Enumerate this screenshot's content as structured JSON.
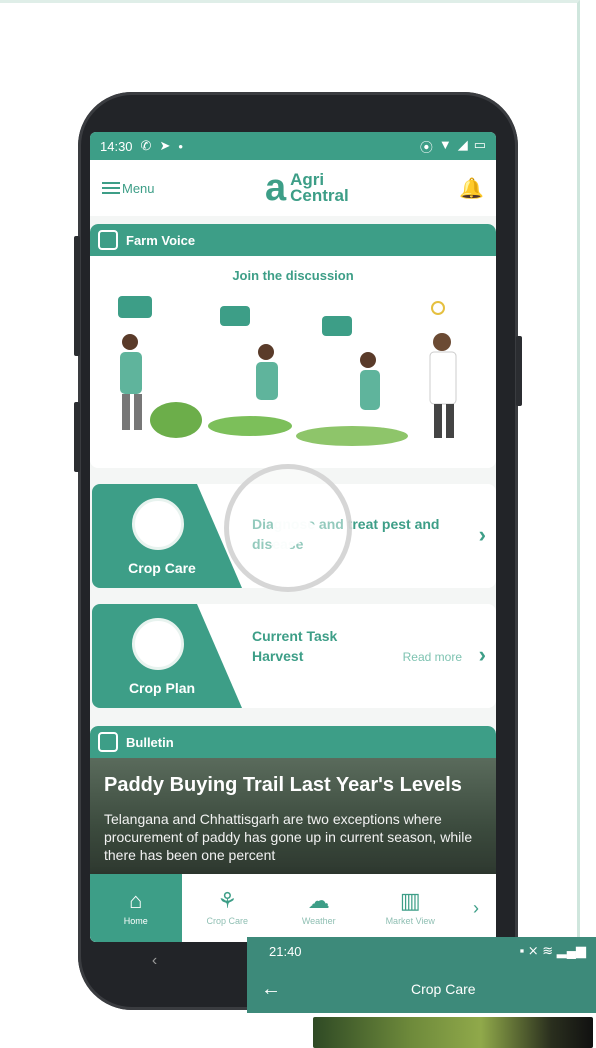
{
  "status_bar": {
    "time": "14:30"
  },
  "app_bar": {
    "menu_label": "Menu",
    "brand_line1": "Agri",
    "brand_line2": "Central"
  },
  "farm_voice": {
    "title": "Farm Voice",
    "subtitle": "Join the discussion"
  },
  "crop_care": {
    "label": "Crop Care",
    "text": "Diagnose and treat pest and disease"
  },
  "crop_plan": {
    "label": "Crop Plan",
    "line1": "Current Task",
    "line2": "Harvest",
    "read_more": "Read more"
  },
  "bulletin": {
    "title": "Bulletin",
    "headline": "Paddy Buying Trail Last Year's Levels",
    "body": "Telangana and Chhattisgarh are two exceptions where procurement of paddy has gone up in current season, while there has been one percent"
  },
  "bottom_nav": {
    "items": [
      {
        "label": "Home",
        "icon": "home-icon"
      },
      {
        "label": "Crop Care",
        "icon": "sprout-icon"
      },
      {
        "label": "Weather",
        "icon": "weather-icon"
      },
      {
        "label": "Market View",
        "icon": "chart-icon"
      }
    ]
  },
  "inset": {
    "time": "21:40",
    "title": "Crop Care"
  },
  "colors": {
    "primary": "#3d9e87",
    "inset_bar": "#3d8a7a",
    "bell": "#e59a2a"
  }
}
